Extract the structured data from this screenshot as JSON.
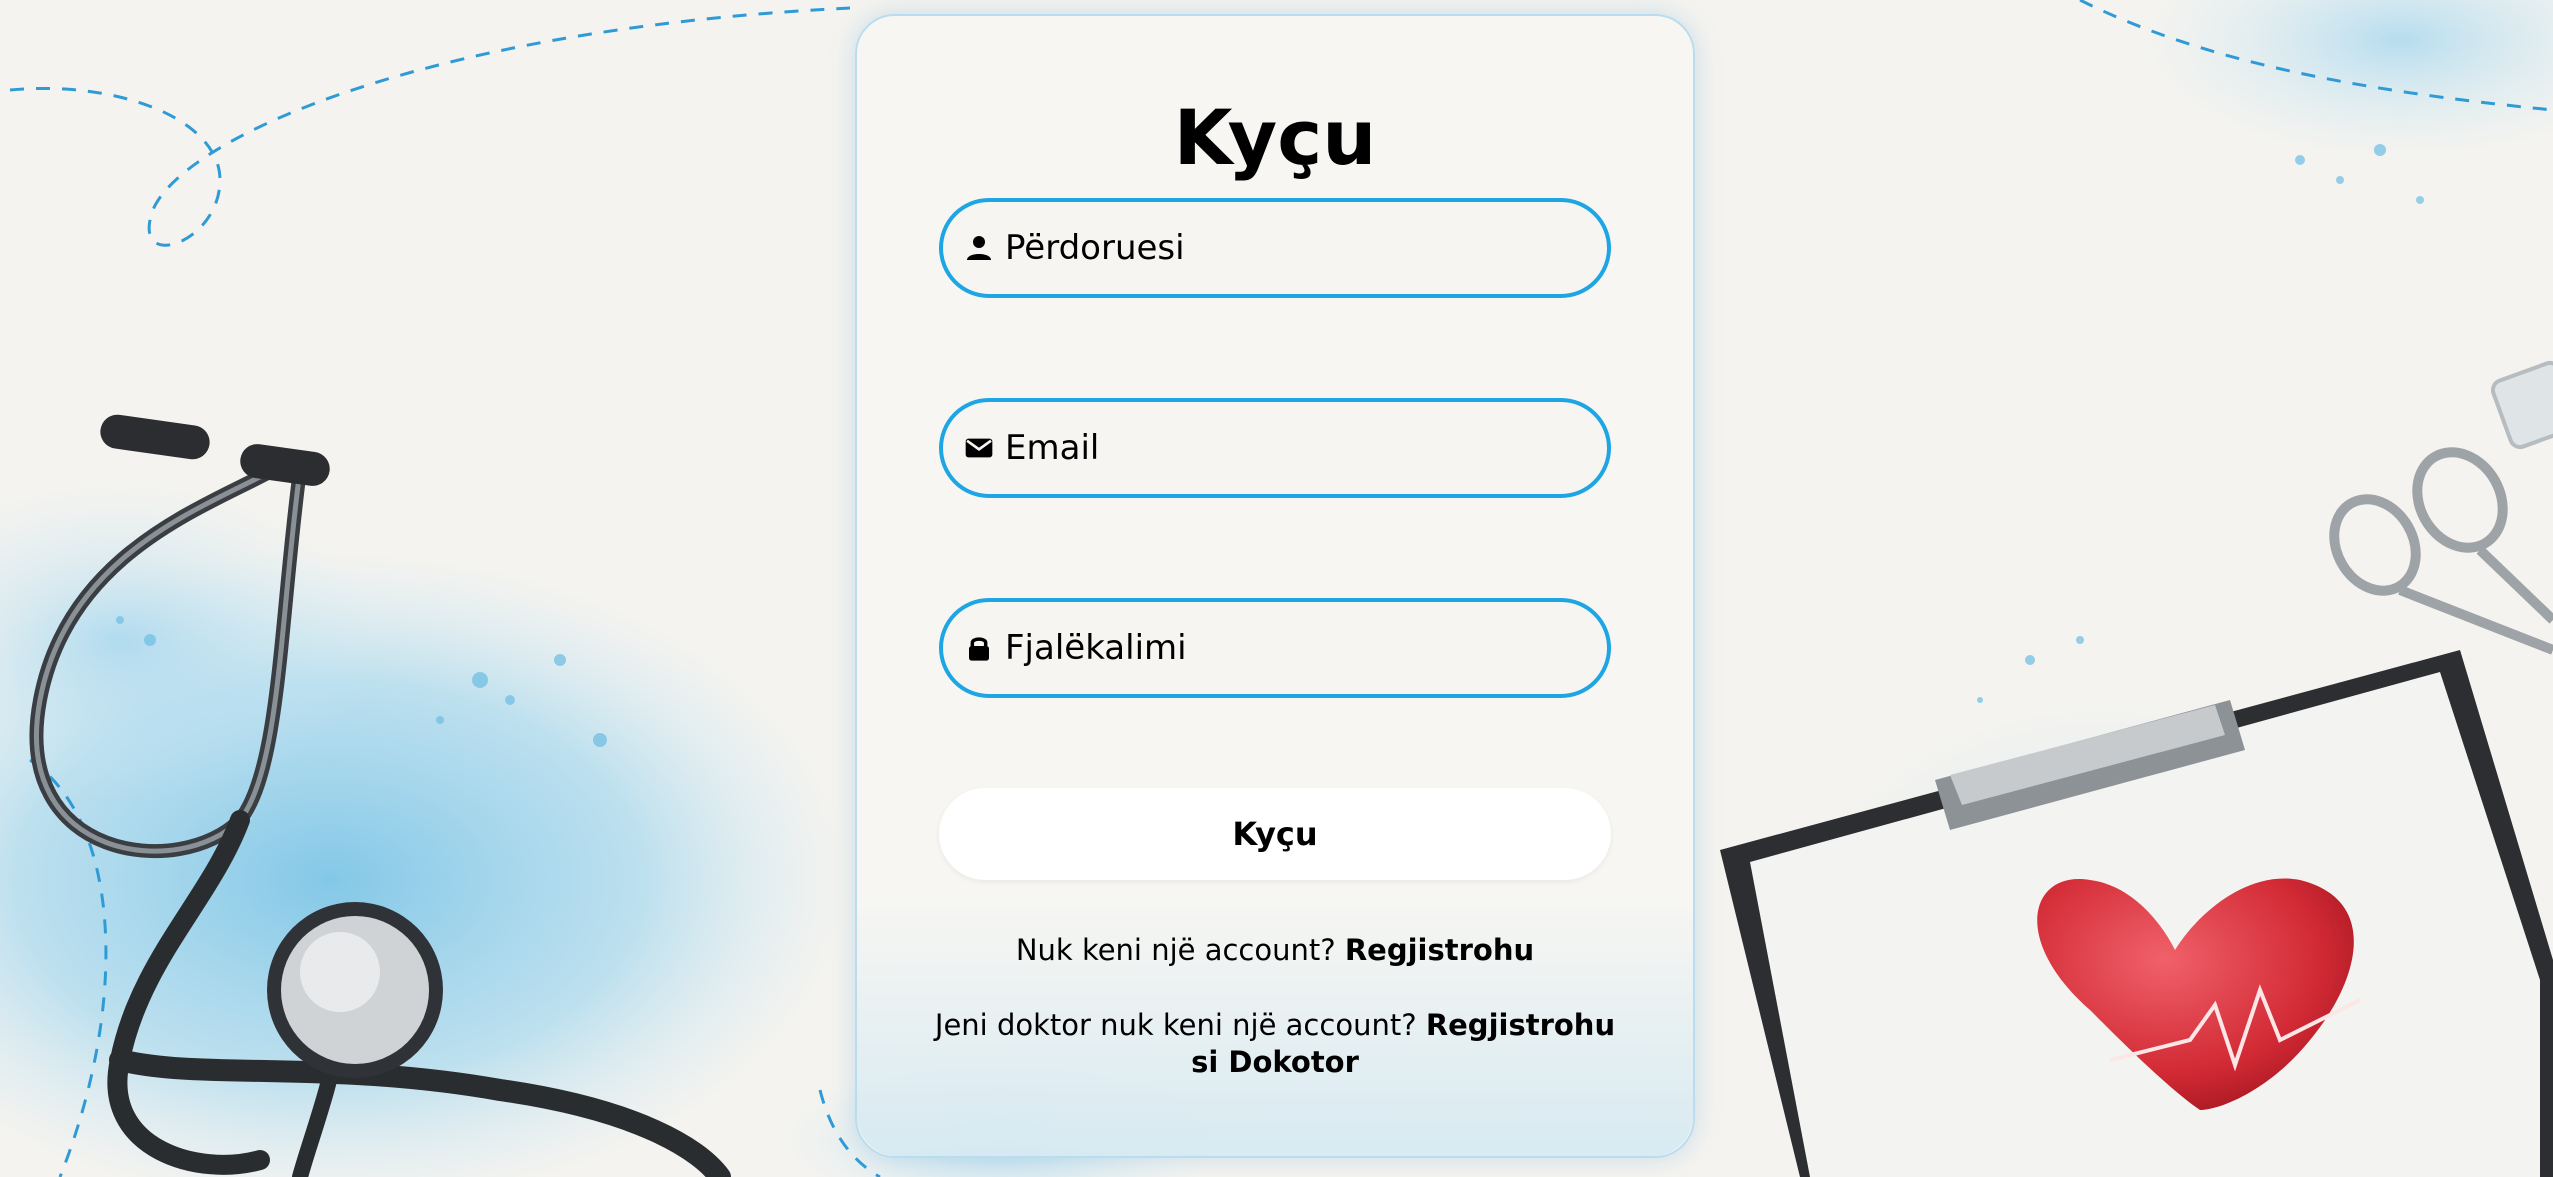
{
  "login": {
    "title": "Kyçu",
    "username": {
      "placeholder": "Përdoruesi",
      "icon": "user-icon"
    },
    "email": {
      "placeholder": "Email",
      "icon": "mail-icon"
    },
    "password": {
      "placeholder": "Fjalëkalimi",
      "icon": "lock-icon"
    },
    "submit_label": "Kyçu",
    "register_prompt": "Nuk keni një account?",
    "register_link": "Regjistrohu",
    "doctor_prompt": "Jeni doktor nuk keni një account?",
    "doctor_link": "Regjistrohu si Dokotor"
  },
  "colors": {
    "accent": "#1ea6e4",
    "card_bg": "#f6f5f2",
    "button_bg": "#ffffff",
    "heart": "#d8323c"
  }
}
